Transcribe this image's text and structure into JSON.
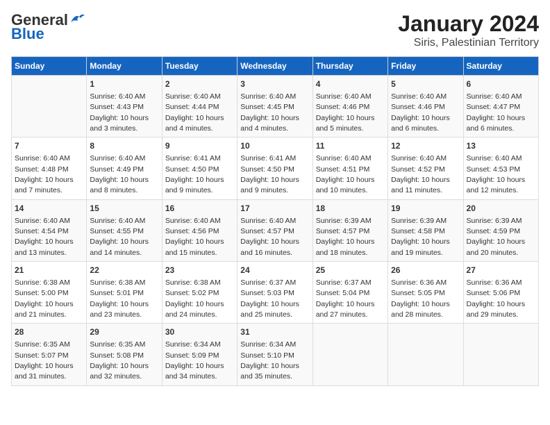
{
  "header": {
    "logo_general": "General",
    "logo_blue": "Blue",
    "title": "January 2024",
    "subtitle": "Siris, Palestinian Territory"
  },
  "days_of_week": [
    "Sunday",
    "Monday",
    "Tuesday",
    "Wednesday",
    "Thursday",
    "Friday",
    "Saturday"
  ],
  "weeks": [
    [
      {
        "day": "",
        "info": ""
      },
      {
        "day": "1",
        "info": "Sunrise: 6:40 AM\nSunset: 4:43 PM\nDaylight: 10 hours\nand 3 minutes."
      },
      {
        "day": "2",
        "info": "Sunrise: 6:40 AM\nSunset: 4:44 PM\nDaylight: 10 hours\nand 4 minutes."
      },
      {
        "day": "3",
        "info": "Sunrise: 6:40 AM\nSunset: 4:45 PM\nDaylight: 10 hours\nand 4 minutes."
      },
      {
        "day": "4",
        "info": "Sunrise: 6:40 AM\nSunset: 4:46 PM\nDaylight: 10 hours\nand 5 minutes."
      },
      {
        "day": "5",
        "info": "Sunrise: 6:40 AM\nSunset: 4:46 PM\nDaylight: 10 hours\nand 6 minutes."
      },
      {
        "day": "6",
        "info": "Sunrise: 6:40 AM\nSunset: 4:47 PM\nDaylight: 10 hours\nand 6 minutes."
      }
    ],
    [
      {
        "day": "7",
        "info": "Sunrise: 6:40 AM\nSunset: 4:48 PM\nDaylight: 10 hours\nand 7 minutes."
      },
      {
        "day": "8",
        "info": "Sunrise: 6:40 AM\nSunset: 4:49 PM\nDaylight: 10 hours\nand 8 minutes."
      },
      {
        "day": "9",
        "info": "Sunrise: 6:41 AM\nSunset: 4:50 PM\nDaylight: 10 hours\nand 9 minutes."
      },
      {
        "day": "10",
        "info": "Sunrise: 6:41 AM\nSunset: 4:50 PM\nDaylight: 10 hours\nand 9 minutes."
      },
      {
        "day": "11",
        "info": "Sunrise: 6:40 AM\nSunset: 4:51 PM\nDaylight: 10 hours\nand 10 minutes."
      },
      {
        "day": "12",
        "info": "Sunrise: 6:40 AM\nSunset: 4:52 PM\nDaylight: 10 hours\nand 11 minutes."
      },
      {
        "day": "13",
        "info": "Sunrise: 6:40 AM\nSunset: 4:53 PM\nDaylight: 10 hours\nand 12 minutes."
      }
    ],
    [
      {
        "day": "14",
        "info": "Sunrise: 6:40 AM\nSunset: 4:54 PM\nDaylight: 10 hours\nand 13 minutes."
      },
      {
        "day": "15",
        "info": "Sunrise: 6:40 AM\nSunset: 4:55 PM\nDaylight: 10 hours\nand 14 minutes."
      },
      {
        "day": "16",
        "info": "Sunrise: 6:40 AM\nSunset: 4:56 PM\nDaylight: 10 hours\nand 15 minutes."
      },
      {
        "day": "17",
        "info": "Sunrise: 6:40 AM\nSunset: 4:57 PM\nDaylight: 10 hours\nand 16 minutes."
      },
      {
        "day": "18",
        "info": "Sunrise: 6:39 AM\nSunset: 4:57 PM\nDaylight: 10 hours\nand 18 minutes."
      },
      {
        "day": "19",
        "info": "Sunrise: 6:39 AM\nSunset: 4:58 PM\nDaylight: 10 hours\nand 19 minutes."
      },
      {
        "day": "20",
        "info": "Sunrise: 6:39 AM\nSunset: 4:59 PM\nDaylight: 10 hours\nand 20 minutes."
      }
    ],
    [
      {
        "day": "21",
        "info": "Sunrise: 6:38 AM\nSunset: 5:00 PM\nDaylight: 10 hours\nand 21 minutes."
      },
      {
        "day": "22",
        "info": "Sunrise: 6:38 AM\nSunset: 5:01 PM\nDaylight: 10 hours\nand 23 minutes."
      },
      {
        "day": "23",
        "info": "Sunrise: 6:38 AM\nSunset: 5:02 PM\nDaylight: 10 hours\nand 24 minutes."
      },
      {
        "day": "24",
        "info": "Sunrise: 6:37 AM\nSunset: 5:03 PM\nDaylight: 10 hours\nand 25 minutes."
      },
      {
        "day": "25",
        "info": "Sunrise: 6:37 AM\nSunset: 5:04 PM\nDaylight: 10 hours\nand 27 minutes."
      },
      {
        "day": "26",
        "info": "Sunrise: 6:36 AM\nSunset: 5:05 PM\nDaylight: 10 hours\nand 28 minutes."
      },
      {
        "day": "27",
        "info": "Sunrise: 6:36 AM\nSunset: 5:06 PM\nDaylight: 10 hours\nand 29 minutes."
      }
    ],
    [
      {
        "day": "28",
        "info": "Sunrise: 6:35 AM\nSunset: 5:07 PM\nDaylight: 10 hours\nand 31 minutes."
      },
      {
        "day": "29",
        "info": "Sunrise: 6:35 AM\nSunset: 5:08 PM\nDaylight: 10 hours\nand 32 minutes."
      },
      {
        "day": "30",
        "info": "Sunrise: 6:34 AM\nSunset: 5:09 PM\nDaylight: 10 hours\nand 34 minutes."
      },
      {
        "day": "31",
        "info": "Sunrise: 6:34 AM\nSunset: 5:10 PM\nDaylight: 10 hours\nand 35 minutes."
      },
      {
        "day": "",
        "info": ""
      },
      {
        "day": "",
        "info": ""
      },
      {
        "day": "",
        "info": ""
      }
    ]
  ]
}
